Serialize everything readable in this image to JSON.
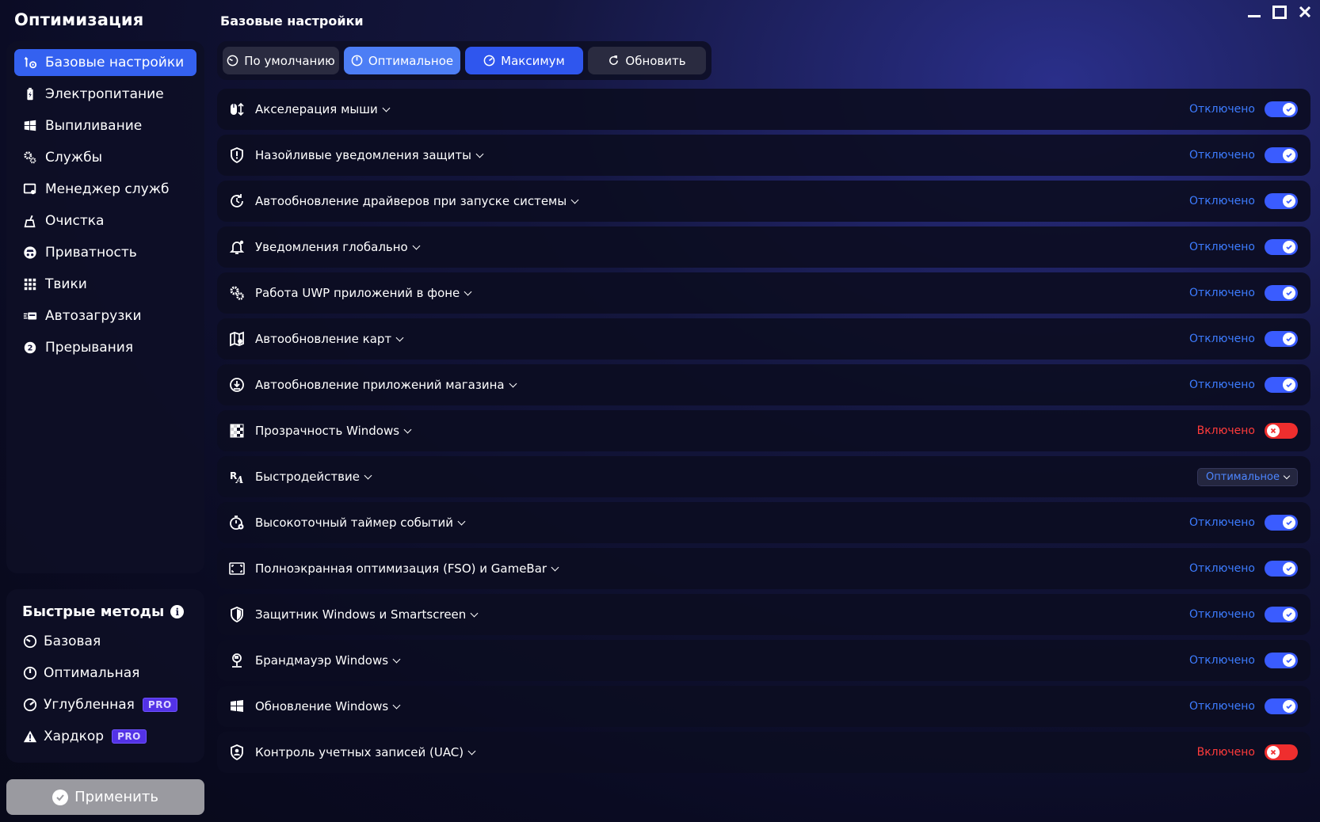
{
  "app": {
    "title": "Оптимизация"
  },
  "sidebar": {
    "items": [
      {
        "label": "Базовые настройки",
        "icon": "tools-icon",
        "active": true
      },
      {
        "label": "Электропитание",
        "icon": "battery-icon"
      },
      {
        "label": "Выпиливание",
        "icon": "windows-icon"
      },
      {
        "label": "Службы",
        "icon": "gears-icon"
      },
      {
        "label": "Менеджер служб",
        "icon": "service-manager-icon"
      },
      {
        "label": "Очистка",
        "icon": "broom-icon"
      },
      {
        "label": "Приватность",
        "icon": "privacy-icon"
      },
      {
        "label": "Твики",
        "icon": "grid-icon"
      },
      {
        "label": "Автозагрузки",
        "icon": "startup-icon"
      },
      {
        "label": "Прерывания",
        "icon": "interrupt-icon"
      }
    ]
  },
  "quick": {
    "title": "Быстрые методы",
    "items": [
      {
        "label": "Базовая",
        "icon": "gauge-low-icon",
        "pro": false
      },
      {
        "label": "Оптимальная",
        "icon": "gauge-mid-icon",
        "pro": false
      },
      {
        "label": "Углубленная",
        "icon": "gauge-high-icon",
        "pro": true
      },
      {
        "label": "Хардкор",
        "icon": "warning-icon",
        "pro": true
      }
    ],
    "pro_label": "PRO"
  },
  "apply_label": "Применить",
  "main": {
    "title": "Базовые настройки",
    "presets": [
      {
        "label": "По умолчанию"
      },
      {
        "label": "Оптимальное"
      },
      {
        "label": "Максимум"
      },
      {
        "label": "Обновить"
      }
    ]
  },
  "settings": [
    {
      "label": "Акселерация мыши",
      "icon": "mouse-icon",
      "status": "Отключено",
      "state": "off"
    },
    {
      "label": "Назойливые уведомления защиты",
      "icon": "shield-icon",
      "status": "Отключено",
      "state": "off"
    },
    {
      "label": "Автообновление драйверов при запуске системы",
      "icon": "refresh-clock-icon",
      "status": "Отключено",
      "state": "off"
    },
    {
      "label": "Уведомления глобально",
      "icon": "bell-icon",
      "status": "Отключено",
      "state": "off"
    },
    {
      "label": "Работа UWP приложений в фоне",
      "icon": "uwp-gear-icon",
      "status": "Отключено",
      "state": "off"
    },
    {
      "label": "Автообновление карт",
      "icon": "map-icon",
      "status": "Отключено",
      "state": "off"
    },
    {
      "label": "Автообновление приложений магазина",
      "icon": "download-icon",
      "status": "Отключено",
      "state": "off"
    },
    {
      "label": "Прозрачность Windows",
      "icon": "transparency-icon",
      "status": "Включено",
      "state": "on"
    },
    {
      "label": "Быстродействие",
      "icon": "performance-icon",
      "select": "Оптимальное"
    },
    {
      "label": "Высокоточный таймер событий",
      "icon": "timer-icon",
      "status": "Отключено",
      "state": "off"
    },
    {
      "label": "Полноэкранная оптимизация (FSO) и GameBar",
      "icon": "fullscreen-icon",
      "status": "Отключено",
      "state": "off"
    },
    {
      "label": "Защитник Windows и Smartscreen",
      "icon": "defender-icon",
      "status": "Отключено",
      "state": "off"
    },
    {
      "label": "Брандмауэр Windows",
      "icon": "firewall-icon",
      "status": "Отключено",
      "state": "off"
    },
    {
      "label": "Обновление Windows",
      "icon": "windows-update-icon",
      "status": "Отключено",
      "state": "off"
    },
    {
      "label": "Контроль учетных записей (UAC)",
      "icon": "uac-icon",
      "status": "Включено",
      "state": "on"
    }
  ],
  "colors": {
    "accent": "#3461f0",
    "off": "#3d7cff",
    "on": "#ff3b3b"
  }
}
